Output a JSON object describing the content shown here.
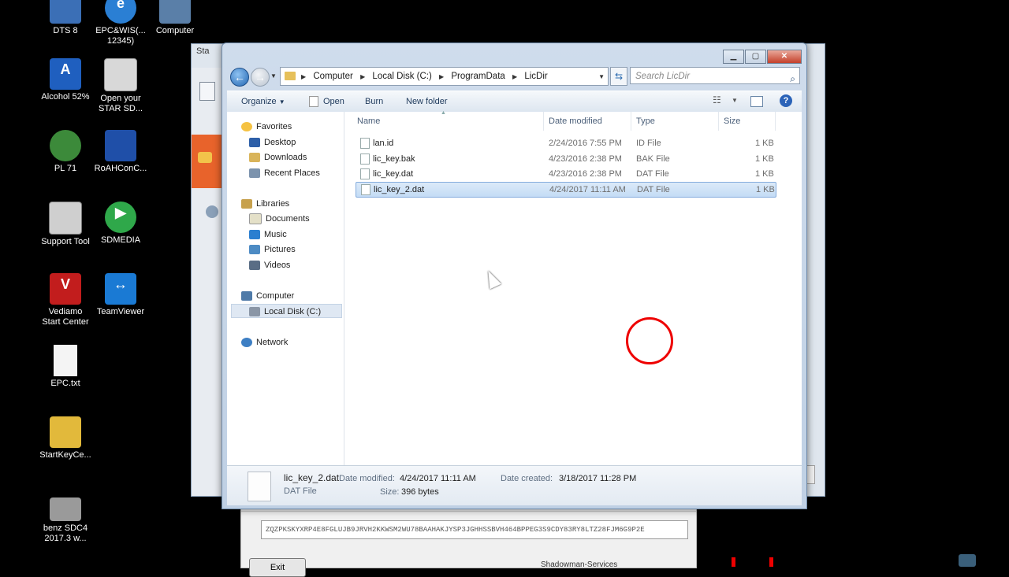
{
  "desktop": {
    "icons": [
      {
        "label": "DTS 8",
        "color": "#3b6fb6"
      },
      {
        "label": "EPC&WIS(...\n12345)",
        "color": "#2a7fd4"
      },
      {
        "label": "Computer",
        "color": "#5a7fa8"
      },
      {
        "label": "Alcohol 52%",
        "color": "#1f5fbf"
      },
      {
        "label": "Open your\nSTAR SD...",
        "color": "#d8d8d8"
      },
      {
        "label": "PL 71",
        "color": "#3c8a3a"
      },
      {
        "label": "RoAHConC...",
        "color": "#1f4fa8"
      },
      {
        "label": "Support Tool",
        "color": "#cfcfcf"
      },
      {
        "label": "SDMEDIA",
        "color": "#2fa84a"
      },
      {
        "label": "Vediamo\nStart Center",
        "color": "#c21d1d"
      },
      {
        "label": "TeamViewer",
        "color": "#1a7ad4"
      },
      {
        "label": "EPC.txt",
        "color": "#f4f4f4"
      },
      {
        "label": "StartKeyCe...",
        "color": "#e2b93b"
      },
      {
        "label": "benz SDC4\n2017.3 w...",
        "color": "#9a9a9a"
      }
    ]
  },
  "background_window": {
    "title": "Sta",
    "licence_key": "ZQZPKSKYXRP4E8FGLUJB9JRVH2KKWSM2WU78BAAHAKJYSP3JGHHSSBVH464BPPEG3S9CDY83RY8LTZ28FJM6G9P2E",
    "exit_label": "Exit",
    "credit": "Shadowman-Services"
  },
  "explorer": {
    "address": [
      "Computer",
      "Local Disk (C:)",
      "ProgramData",
      "LicDir"
    ],
    "search_placeholder": "Search LicDir",
    "toolbar": {
      "organize": "Organize",
      "open": "Open",
      "burn": "Burn",
      "new_folder": "New folder"
    },
    "nav": {
      "favorites": "Favorites",
      "desktop": "Desktop",
      "downloads": "Downloads",
      "recent_places": "Recent Places",
      "libraries": "Libraries",
      "documents": "Documents",
      "music": "Music",
      "pictures": "Pictures",
      "videos": "Videos",
      "computer": "Computer",
      "local_disk": "Local Disk (C:)",
      "network": "Network"
    },
    "columns": {
      "name": "Name",
      "date_modified": "Date modified",
      "type": "Type",
      "size": "Size"
    },
    "files": [
      {
        "name": "lan.id",
        "date": "2/24/2016 7:55 PM",
        "type": "ID File",
        "size": "1 KB"
      },
      {
        "name": "lic_key.bak",
        "date": "4/23/2016 2:38 PM",
        "type": "BAK File",
        "size": "1 KB"
      },
      {
        "name": "lic_key.dat",
        "date": "4/23/2016 2:38 PM",
        "type": "DAT File",
        "size": "1 KB"
      },
      {
        "name": "lic_key_2.dat",
        "date": "4/24/2017 11:11 AM",
        "type": "DAT File",
        "size": "1 KB"
      }
    ],
    "details": {
      "name": "lic_key_2.dat",
      "type": "DAT File",
      "date_modified_label": "Date modified:",
      "date_modified": "4/24/2017 11:11 AM",
      "size_label": "Size:",
      "size": "396 bytes",
      "date_created_label": "Date created:",
      "date_created": "3/18/2017 11:28 PM"
    }
  }
}
